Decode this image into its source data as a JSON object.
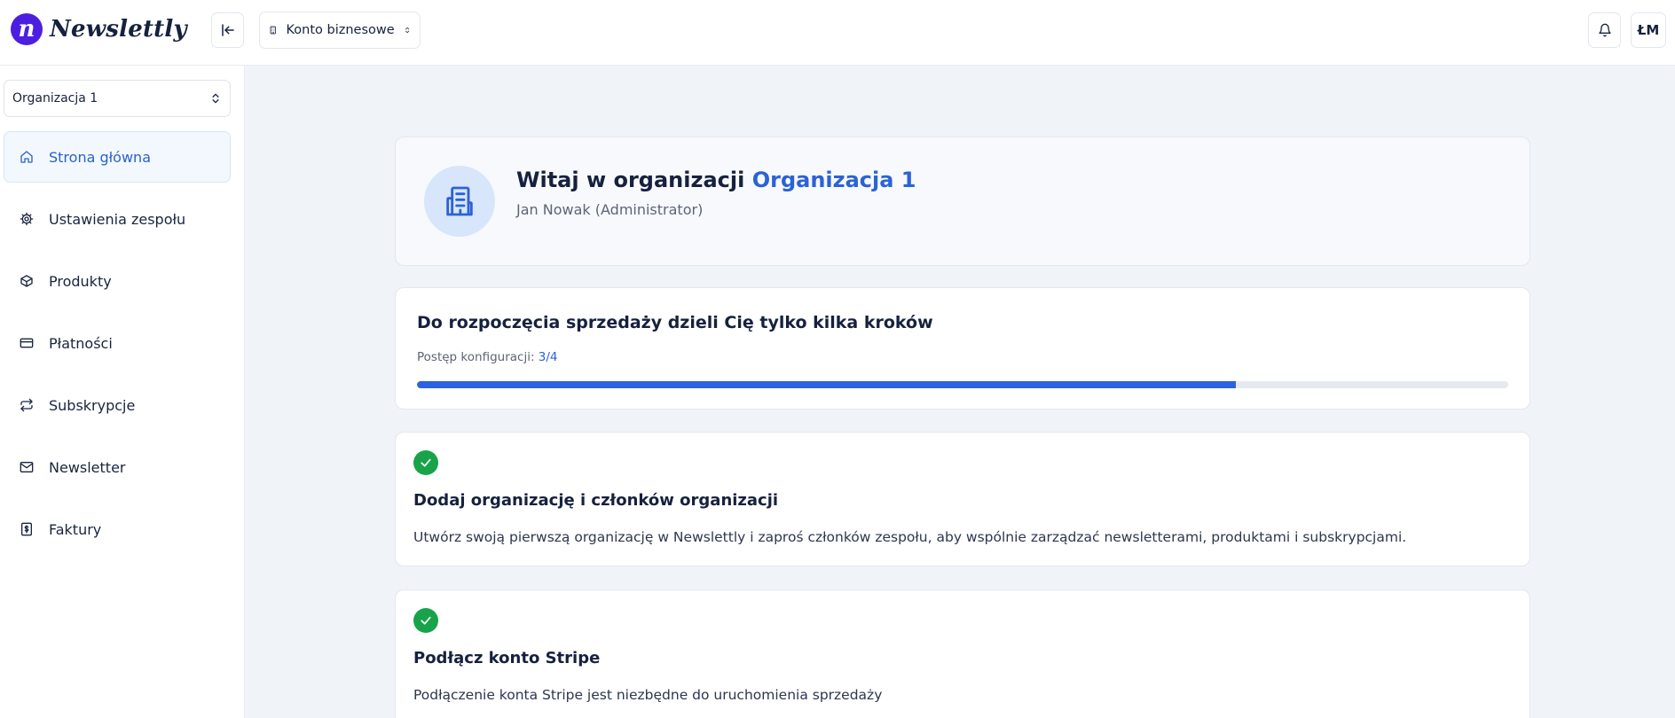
{
  "app": {
    "logo_letter": "n",
    "name": "Newslettly"
  },
  "header": {
    "account_switcher_label": "Konto biznesowe",
    "user_initials": "ŁM"
  },
  "sidebar": {
    "org_select_value": "Organizacja 1",
    "items": [
      {
        "label": "Strona główna",
        "icon": "home-icon",
        "active": true
      },
      {
        "label": "Ustawienia zespołu",
        "icon": "gear-icon",
        "active": false
      },
      {
        "label": "Produkty",
        "icon": "box-icon",
        "active": false
      },
      {
        "label": "Płatności",
        "icon": "credit-card-icon",
        "active": false
      },
      {
        "label": "Subskrypcje",
        "icon": "repeat-icon",
        "active": false
      },
      {
        "label": "Newsletter",
        "icon": "mail-icon",
        "active": false
      },
      {
        "label": "Faktury",
        "icon": "invoice-icon",
        "active": false
      }
    ]
  },
  "welcome": {
    "title_prefix": "Witaj w organizacji",
    "org_name": "Organizacja 1",
    "subtitle": "Jan Nowak (Administrator)"
  },
  "progress": {
    "title": "Do rozpoczęcia sprzedaży dzieli Cię tylko kilka kroków",
    "label": "Postęp konfiguracji:",
    "value_text": "3/4",
    "fraction": 0.75
  },
  "steps": [
    {
      "done": true,
      "title": "Dodaj organizację i członków organizacji",
      "description": "Utwórz swoją pierwszą organizację w Newslettly i zaproś członków zespołu, aby wspólnie zarządzać newsletterami, produktami i subskrypcjami."
    },
    {
      "done": true,
      "title": "Podłącz konto Stripe",
      "description": "Podłączenie konta Stripe jest niezbędne do uruchomienia sprzedaży"
    }
  ],
  "colors": {
    "brand": "#4c1fe0",
    "accent": "#2b62e3",
    "success": "#18a34a",
    "active_nav_bg": "#f3f8fe"
  }
}
